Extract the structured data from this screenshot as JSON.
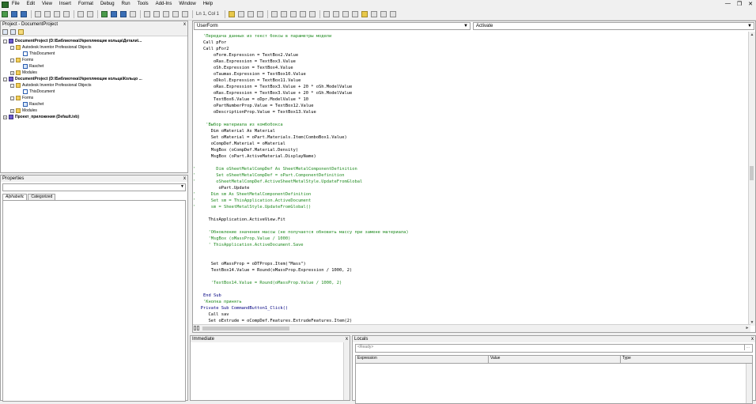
{
  "menu": {
    "items": [
      "File",
      "Edit",
      "View",
      "Insert",
      "Format",
      "Debug",
      "Run",
      "Tools",
      "Add-Ins",
      "Window",
      "Help"
    ],
    "win_min": "—",
    "win_restore": "❐",
    "win_close": "✕"
  },
  "toolbar": {
    "position": "Ln 1, Col 1"
  },
  "project_pane": {
    "title": "Project - DocumentProject",
    "close": "x",
    "tree": [
      {
        "text": "DocumentProject (D:\\Библиотека\\Укрепляющие кольца\\Детали\\...",
        "level": 0,
        "icon": "proj",
        "bold": true,
        "exp": "-"
      },
      {
        "text": "Autodesk Inventor Professional Objects",
        "level": 1,
        "icon": "fold",
        "bold": false,
        "exp": "-"
      },
      {
        "text": "ThisDocument",
        "level": 2,
        "icon": "doc",
        "bold": false,
        "exp": ""
      },
      {
        "text": "Forms",
        "level": 1,
        "icon": "fold",
        "bold": false,
        "exp": "-"
      },
      {
        "text": "Raschet",
        "level": 2,
        "icon": "form",
        "bold": false,
        "exp": ""
      },
      {
        "text": "Modules",
        "level": 1,
        "icon": "fold",
        "bold": false,
        "exp": "+"
      },
      {
        "text": "DocumentProject (D:\\Библиотека\\Укрепляющие кольца\\Кольцо ...",
        "level": 0,
        "icon": "proj",
        "bold": true,
        "exp": "-"
      },
      {
        "text": "Autodesk Inventor Professional Objects",
        "level": 1,
        "icon": "fold",
        "bold": false,
        "exp": "-"
      },
      {
        "text": "ThisDocument",
        "level": 2,
        "icon": "doc",
        "bold": false,
        "exp": ""
      },
      {
        "text": "Forms",
        "level": 1,
        "icon": "fold",
        "bold": false,
        "exp": "-"
      },
      {
        "text": "Raschet",
        "level": 2,
        "icon": "form",
        "bold": false,
        "exp": ""
      },
      {
        "text": "Modules",
        "level": 1,
        "icon": "fold",
        "bold": false,
        "exp": "+"
      },
      {
        "text": "Проект_приложения (Default.ivb)",
        "level": 0,
        "icon": "proj",
        "bold": true,
        "exp": "+"
      }
    ]
  },
  "properties_pane": {
    "title": "Properties",
    "close": "x",
    "combo_value": "",
    "tab_alpha": "Alphabetic",
    "tab_cat": "Categorized"
  },
  "code_window": {
    "object_combo": "UserForm",
    "proc_combo": "Activate",
    "lines": [
      {
        "text": "    'Передача данных из текст боксы в параметры модели",
        "cls": "cm"
      },
      {
        "text": "    Call pFor",
        "cls": ""
      },
      {
        "text": "    Call pFor2",
        "cls": ""
      },
      {
        "text": "        oForm.Expression = TextBox2.Value",
        "cls": ""
      },
      {
        "text": "        oRas.Expression = TextBox3.Value",
        "cls": ""
      },
      {
        "text": "        oSh.Expression = TextBox4.Value",
        "cls": ""
      },
      {
        "text": "        oTaumas.Expression = TextBox10.Value",
        "cls": ""
      },
      {
        "text": "        oDkol.Expression = TextBox11.Value",
        "cls": ""
      },
      {
        "text": "        oRas.Expression = TextBox3.Value + 20 * oSh.ModelValue",
        "cls": ""
      },
      {
        "text": "        oRas.Expression = TextBox3.Value + 20 * oSh.ModelValue",
        "cls": ""
      },
      {
        "text": "        TextBox6.Value = oDpr.ModelValue * 10",
        "cls": ""
      },
      {
        "text": "        oPartNumberProp.Value = TextBox12.Value",
        "cls": ""
      },
      {
        "text": "        oDescriptionProp.Value = TextBox13.Value",
        "cls": ""
      },
      {
        "text": "",
        "cls": ""
      },
      {
        "text": "     'Выбор материала из комбобокса",
        "cls": "cm"
      },
      {
        "text": "       Dim oMaterial As Material",
        "cls": ""
      },
      {
        "text": "       Set oMaterial = oPart.Materials.Item(ComboBox1.Value)",
        "cls": ""
      },
      {
        "text": "       oCompDef.Material = oMaterial",
        "cls": ""
      },
      {
        "text": "       MsgBox (oCompDef.Material.Density)",
        "cls": ""
      },
      {
        "text": "       MsgBox (oPart.ActiveMaterial.DisplayName)",
        "cls": ""
      },
      {
        "text": "",
        "cls": ""
      },
      {
        "text": "'        Dim oSheetMetalCompDef As SheetMetalComponentDefinition",
        "cls": "cm"
      },
      {
        "text": "'        Set oSheetMetalCompDef = oPart.ComponentDefinition",
        "cls": "cm"
      },
      {
        "text": "'        oSheetMetalCompDef.ActiveSheetMetalStyle.UpdateFromGlobal",
        "cls": "cm"
      },
      {
        "text": "          oPart.Update",
        "cls": ""
      },
      {
        "text": "'      Dim sm As SheetMetalComponentDefinition",
        "cls": "cm"
      },
      {
        "text": "'      Set sm = ThisApplication.ActiveDocument",
        "cls": "cm"
      },
      {
        "text": "'      sm = SheetMetalStyle.UpdateFromGlobal()",
        "cls": "cm"
      },
      {
        "text": "",
        "cls": ""
      },
      {
        "text": "      ThisApplication.ActiveView.Fit",
        "cls": ""
      },
      {
        "text": "",
        "cls": ""
      },
      {
        "text": "      'Обновление значения массы (не получается обновить массу при замене материала)",
        "cls": "cm"
      },
      {
        "text": "      'MsgBox (oMassProp.Value / 1000)",
        "cls": "cm"
      },
      {
        "text": "      ' ThisApplication.ActiveDocument.Save",
        "cls": "cm"
      },
      {
        "text": "",
        "cls": ""
      },
      {
        "text": "",
        "cls": ""
      },
      {
        "text": "       Set oMassProp = oDTProps.Item(\"Mass\")",
        "cls": ""
      },
      {
        "text": "       TextBox14.Value = Round(oMassProp.Expression / 1000, 2)",
        "cls": ""
      },
      {
        "text": "",
        "cls": ""
      },
      {
        "text": "       'TextBox14.Value = Round(oMassProp.Value / 1000, 2)",
        "cls": "cm"
      },
      {
        "text": "",
        "cls": ""
      },
      {
        "text": "    End Sub",
        "cls": "kw"
      },
      {
        "text": "    'Кнопка принять",
        "cls": "cm"
      },
      {
        "text": "   Private Sub CommandButton1_Click()",
        "cls": "kw"
      },
      {
        "text": "      Call sav",
        "cls": ""
      },
      {
        "text": "      Set oExtrude = oCompDef.Features.ExtrudeFeatures.Item(2)",
        "cls": ""
      }
    ]
  },
  "immediate_pane": {
    "title": "Immediate",
    "close": "x"
  },
  "locals_pane": {
    "title": "Locals",
    "close": "x",
    "context": "<Ready>",
    "dots": "...",
    "col_expression": "Expression",
    "col_value": "Value",
    "col_type": "Type"
  }
}
